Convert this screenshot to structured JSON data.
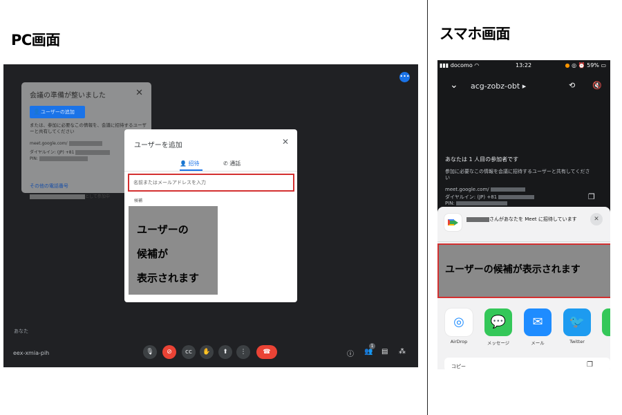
{
  "headings": {
    "pc": "PC画面",
    "sp": "スマホ画面"
  },
  "pc": {
    "more_icon": "more-icon",
    "ready_panel": {
      "title": "会議の準備が整いました",
      "add_user_button": "ユーザーの追加",
      "description": "または、参加に必要なこの情報を、会議に招待するユーザーと共有してください",
      "meet_url_prefix": "meet.google.com/",
      "dial_in": "ダイヤルイン: (JP) +81",
      "pin": "PIN:",
      "other_numbers_link": "その他の電話番号",
      "joined_suffix": "として参加中"
    },
    "dialog": {
      "title": "ユーザーを追加",
      "tab_invite": "招待",
      "tab_call": "通話",
      "input_placeholder": "名前またはメールアドレスを入力",
      "candidates_label": "候補",
      "candidates_line1": "ユーザーの",
      "candidates_line2": "候補が",
      "candidates_line3": "表示されます"
    },
    "you_label": "あなた",
    "meeting_code": "eex-xmia-pih",
    "people_count": "1",
    "colors": {
      "background": "#202124",
      "accent": "#1a73e8",
      "danger": "#ea4335"
    }
  },
  "sp": {
    "status": {
      "carrier": "docomo",
      "time": "13:22",
      "battery": "59%"
    },
    "meeting_code": "acg-zobz-obt",
    "participant_text": "あなたは 1 人目の参加者です",
    "description": "参加に必要なこの情報を会議に招待するユーザーと共有してください",
    "meet_url_prefix": "meet.google.com/",
    "dial_in": "ダイヤルイン: (JP) +81",
    "pin": "PIN:",
    "share": {
      "invite_text": "さんがあなたを Meet に招待しています",
      "candidates": "ユーザーの候補が表示されます",
      "apps": [
        {
          "label": "AirDrop",
          "color": "#ffffff"
        },
        {
          "label": "メッセージ",
          "color": "#34c759"
        },
        {
          "label": "メール",
          "color": "#1e8cff"
        },
        {
          "label": "Twitter",
          "color": "#1d9bf0"
        }
      ],
      "copy_label": "コピー"
    }
  }
}
